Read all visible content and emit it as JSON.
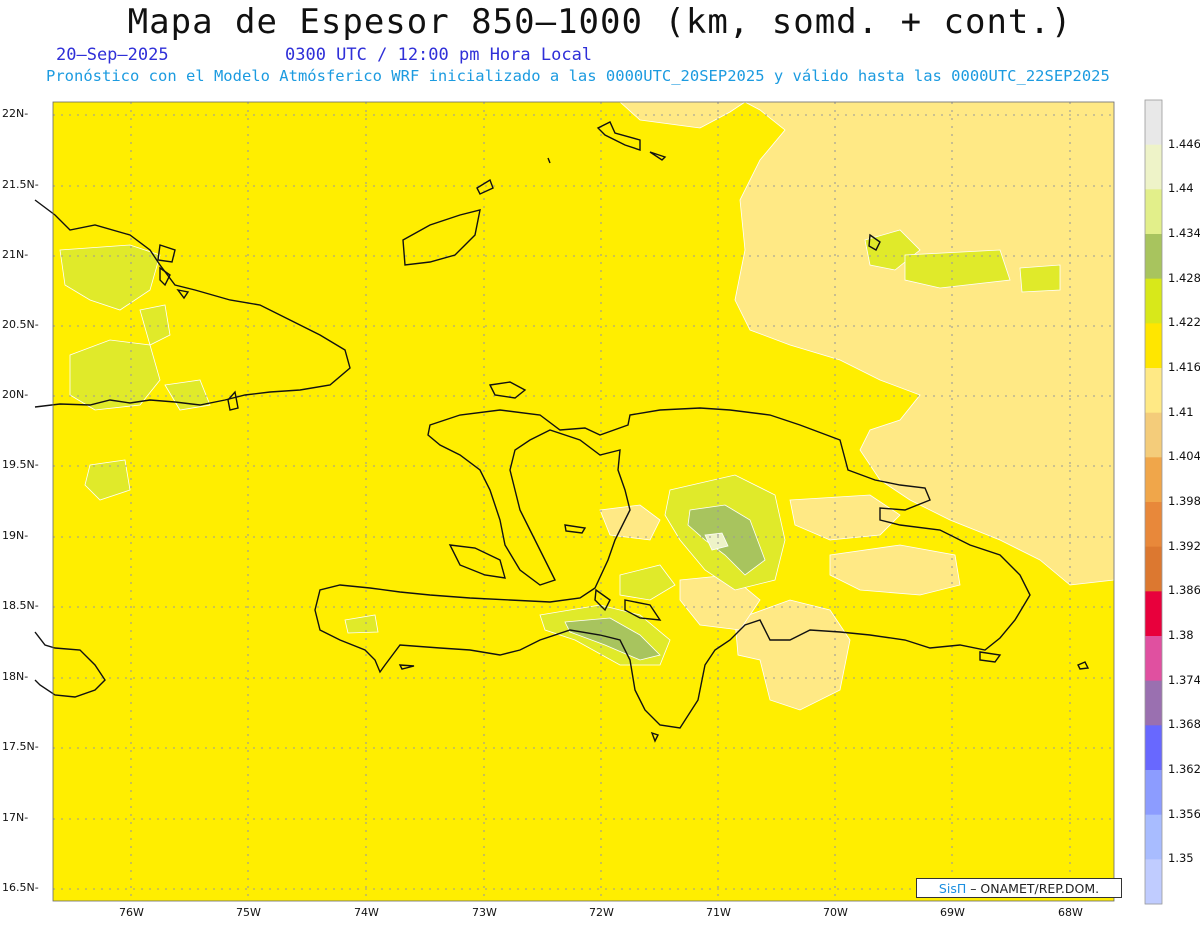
{
  "header": {
    "title": "Mapa de Espesor 850–1000 (km, somd. + cont.)",
    "date": "20–Sep–2025",
    "time": "0300 UTC / 12:00 pm Hora Local",
    "info": "Pronóstico con el Modelo Atmósferico WRF inicializado a las 0000UTC_20SEP2025 y válido hasta las  0000UTC_22SEP2025"
  },
  "axes": {
    "lat_labels": [
      "22N",
      "21.5N",
      "21N",
      "20.5N",
      "20N",
      "19.5N",
      "19N",
      "18.5N",
      "18N",
      "17.5N",
      "17N",
      "16.5N"
    ],
    "lon_labels": [
      "76W",
      "75W",
      "74W",
      "73W",
      "72W",
      "71W",
      "70W",
      "69W",
      "68W"
    ]
  },
  "legend": {
    "labels": [
      "1.446",
      "1.44",
      "1.434",
      "1.428",
      "1.422",
      "1.416",
      "1.41",
      "1.404",
      "1.398",
      "1.392",
      "1.386",
      "1.38",
      "1.374",
      "1.368",
      "1.362",
      "1.356",
      "1.35"
    ],
    "colors": [
      "#e8e8e8",
      "#eef3c8",
      "#e2ef8a",
      "#a8c45e",
      "#d8e81a",
      "#ffe600",
      "#ffe985",
      "#f4cc7a",
      "#f0a64a",
      "#e8883a",
      "#dc7830",
      "#e8003c",
      "#e050a0",
      "#9a70b0",
      "#6868ff",
      "#8c9cff",
      "#a8bcff",
      "#c0ccff"
    ]
  },
  "map": {
    "base_color": "#ffee00",
    "region_colors": {
      "lower": "#ffe985",
      "higher": "#e0ea2a",
      "highest": "#a8c45e",
      "peak": "#eef3c8"
    },
    "coast_color": "#111111",
    "grid_color": "#9a9a9a"
  },
  "credit": {
    "sis": "SisΠ",
    "text": " – ONAMET/REP.DOM."
  }
}
